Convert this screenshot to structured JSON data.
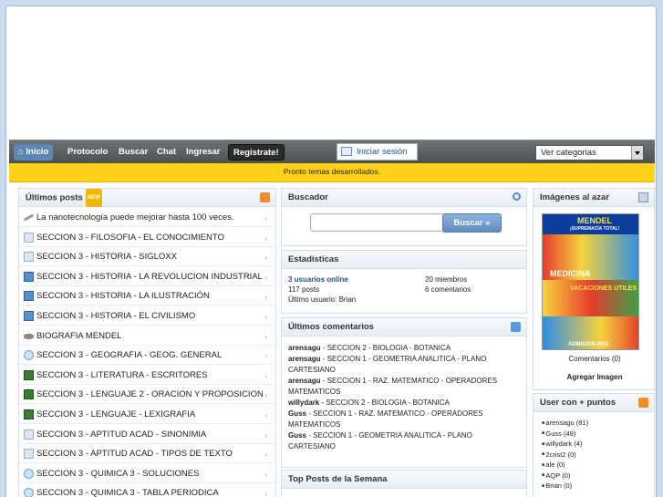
{
  "nav": {
    "home": "Inicio",
    "items": [
      "Protocolo",
      "Buscar",
      "Chat",
      "Ingresar"
    ],
    "register": "Registrate!",
    "login": "Iniciar sesión",
    "categories": "Ver categorias"
  },
  "notice": "Pronto temas desarrollados.",
  "latest_posts": {
    "title": "Últimos posts",
    "badge": "NEW",
    "items": [
      {
        "icon": "pen-icon",
        "label": "La nanotecnología puede mejorar hasta 100 veces."
      },
      {
        "icon": "category-icon",
        "label": "SECCION 3 - FILOSOFIA - EL CONOCIMIENTO"
      },
      {
        "icon": "category-icon",
        "label": "SECCION 3 - HISTORIA - SIGLOXX"
      },
      {
        "icon": "computer-icon",
        "label": "SECCION 3 - HISTORIA - LA REVOLUCION INDUSTRIAL"
      },
      {
        "icon": "computer-icon",
        "label": "SECCION 3 - HISTORIA - LA ILUSTRACIÓN"
      },
      {
        "icon": "computer-icon",
        "label": "SECCION 3 - HISTORIA - EL CIVILISMO"
      },
      {
        "icon": "link-icon",
        "label": "BIOGRAFIA MENDEL"
      },
      {
        "icon": "chat-icon",
        "label": "SECCION 3 - GEOGRAFIA - GEOG. GENERAL"
      },
      {
        "icon": "book-icon",
        "label": "SECCION 3 - LITERATURA - ESCRITORES"
      },
      {
        "icon": "book-icon",
        "label": "SECCION 3 - LENGUAJE 2 - ORACION Y PROPOSICION"
      },
      {
        "icon": "book-icon",
        "label": "SECCION 3 - LENGUAJE - LEXIGRAFIA"
      },
      {
        "icon": "category-icon",
        "label": "SECCION 3 - APTITUD ACAD - SINONIMIA"
      },
      {
        "icon": "category-icon",
        "label": "SECCION 3 - APTITUD ACAD - TIPOS DE TEXTO"
      },
      {
        "icon": "chat-icon",
        "label": "SECCION 3 - QUIMICA 3 - SOLUCIONES"
      },
      {
        "icon": "chat-icon",
        "label": "SECCION 3 - QUIMICA 3 - TABLA PERIODICA"
      }
    ]
  },
  "search": {
    "title": "Buscador",
    "button": "Buscar »"
  },
  "stats": {
    "title": "Estadísticas",
    "online": "3 usuarios online",
    "members": "20 miembros",
    "posts": "117 posts",
    "comments": "6 comentarios",
    "last_user": "Último usuario: Brian"
  },
  "latest_comments": {
    "title": "Últimos comentarios",
    "items": [
      {
        "user": "arensagu",
        "text": " - SECCION 2 - BIOLOGIA - BOTANICA"
      },
      {
        "user": "arensagu",
        "text": " - SECCION 1 - GEOMETRIA ANALITICA - PLANO CARTESIANO"
      },
      {
        "user": "arensagu",
        "text": " - SECCION 1 - RAZ. MATEMATICO - OPERADORES MATEMATICOS"
      },
      {
        "user": "willydark",
        "text": " - SECCION 2 - BIOLOGIA - BOTANICA"
      },
      {
        "user": "Guss",
        "text": " - SECCION 1 - RAZ. MATEMATICO - OPERADORES MATEMATICOS"
      },
      {
        "user": "Guss",
        "text": " - SECCION 1 - GEOMETRIA ANALITICA - PLANO CARTESIANO"
      }
    ]
  },
  "top_posts": {
    "title": "Top Posts de la Semana"
  },
  "random_images": {
    "title": "Imágenes al azar",
    "comments": "Comentarios (0)",
    "add": "Agregar Imagen",
    "img_text": {
      "top": "MENDEL",
      "sub": "¡SUPREMACÍA TOTAL!",
      "mid": "MEDICINA",
      "low": "VACACIONES UTILES",
      "bottom": "ADMISION 2011"
    }
  },
  "top_users": {
    "title": "User con + puntos",
    "items": [
      "arensagu (81)",
      "Guss (49)",
      "willydark (4)",
      "2crist2 (0)",
      "ale (0)",
      "AQP (0)",
      "Brian (0)"
    ]
  }
}
